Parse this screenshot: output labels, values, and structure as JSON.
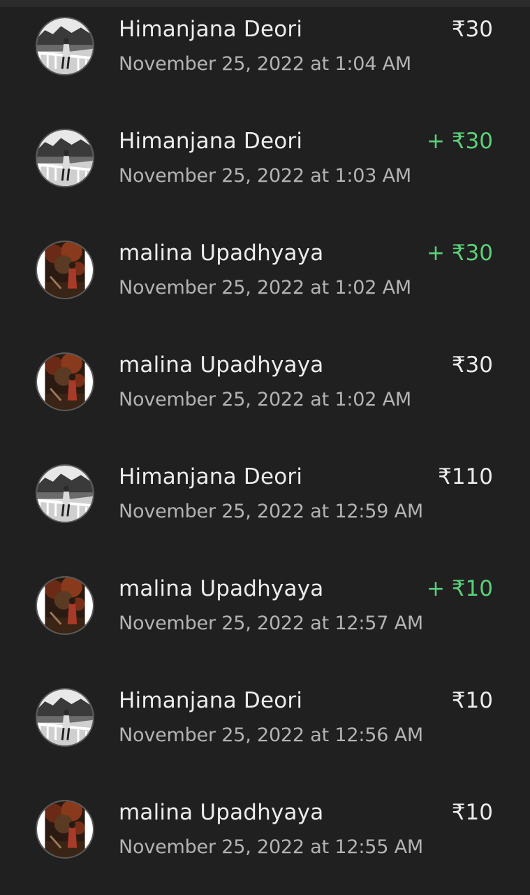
{
  "transactions": [
    {
      "name": "Himanjana Deori",
      "date": "November 25, 2022 at 1:04 AM",
      "amount": "₹30",
      "credit": false,
      "avatar": "bridge"
    },
    {
      "name": "Himanjana Deori",
      "date": "November 25, 2022 at 1:03 AM",
      "amount": "+ ₹30",
      "credit": true,
      "avatar": "bridge"
    },
    {
      "name": "malina Upadhyaya",
      "date": "November 25, 2022 at 1:02 AM",
      "amount": "+ ₹30",
      "credit": true,
      "avatar": "forest"
    },
    {
      "name": "malina Upadhyaya",
      "date": "November 25, 2022 at 1:02 AM",
      "amount": "₹30",
      "credit": false,
      "avatar": "forest"
    },
    {
      "name": "Himanjana Deori",
      "date": "November 25, 2022 at 12:59 AM",
      "amount": "₹110",
      "credit": false,
      "avatar": "bridge"
    },
    {
      "name": "malina Upadhyaya",
      "date": "November 25, 2022 at 12:57 AM",
      "amount": "+ ₹10",
      "credit": true,
      "avatar": "forest"
    },
    {
      "name": "Himanjana Deori",
      "date": "November 25, 2022 at 12:56 AM",
      "amount": "₹10",
      "credit": false,
      "avatar": "bridge"
    },
    {
      "name": "malina Upadhyaya",
      "date": "November 25, 2022 at 12:55 AM",
      "amount": "₹10",
      "credit": false,
      "avatar": "forest"
    }
  ],
  "colors": {
    "background": "#202020",
    "primary_text": "#ececec",
    "secondary_text": "#b3b3b3",
    "credit": "#5ad17a"
  }
}
